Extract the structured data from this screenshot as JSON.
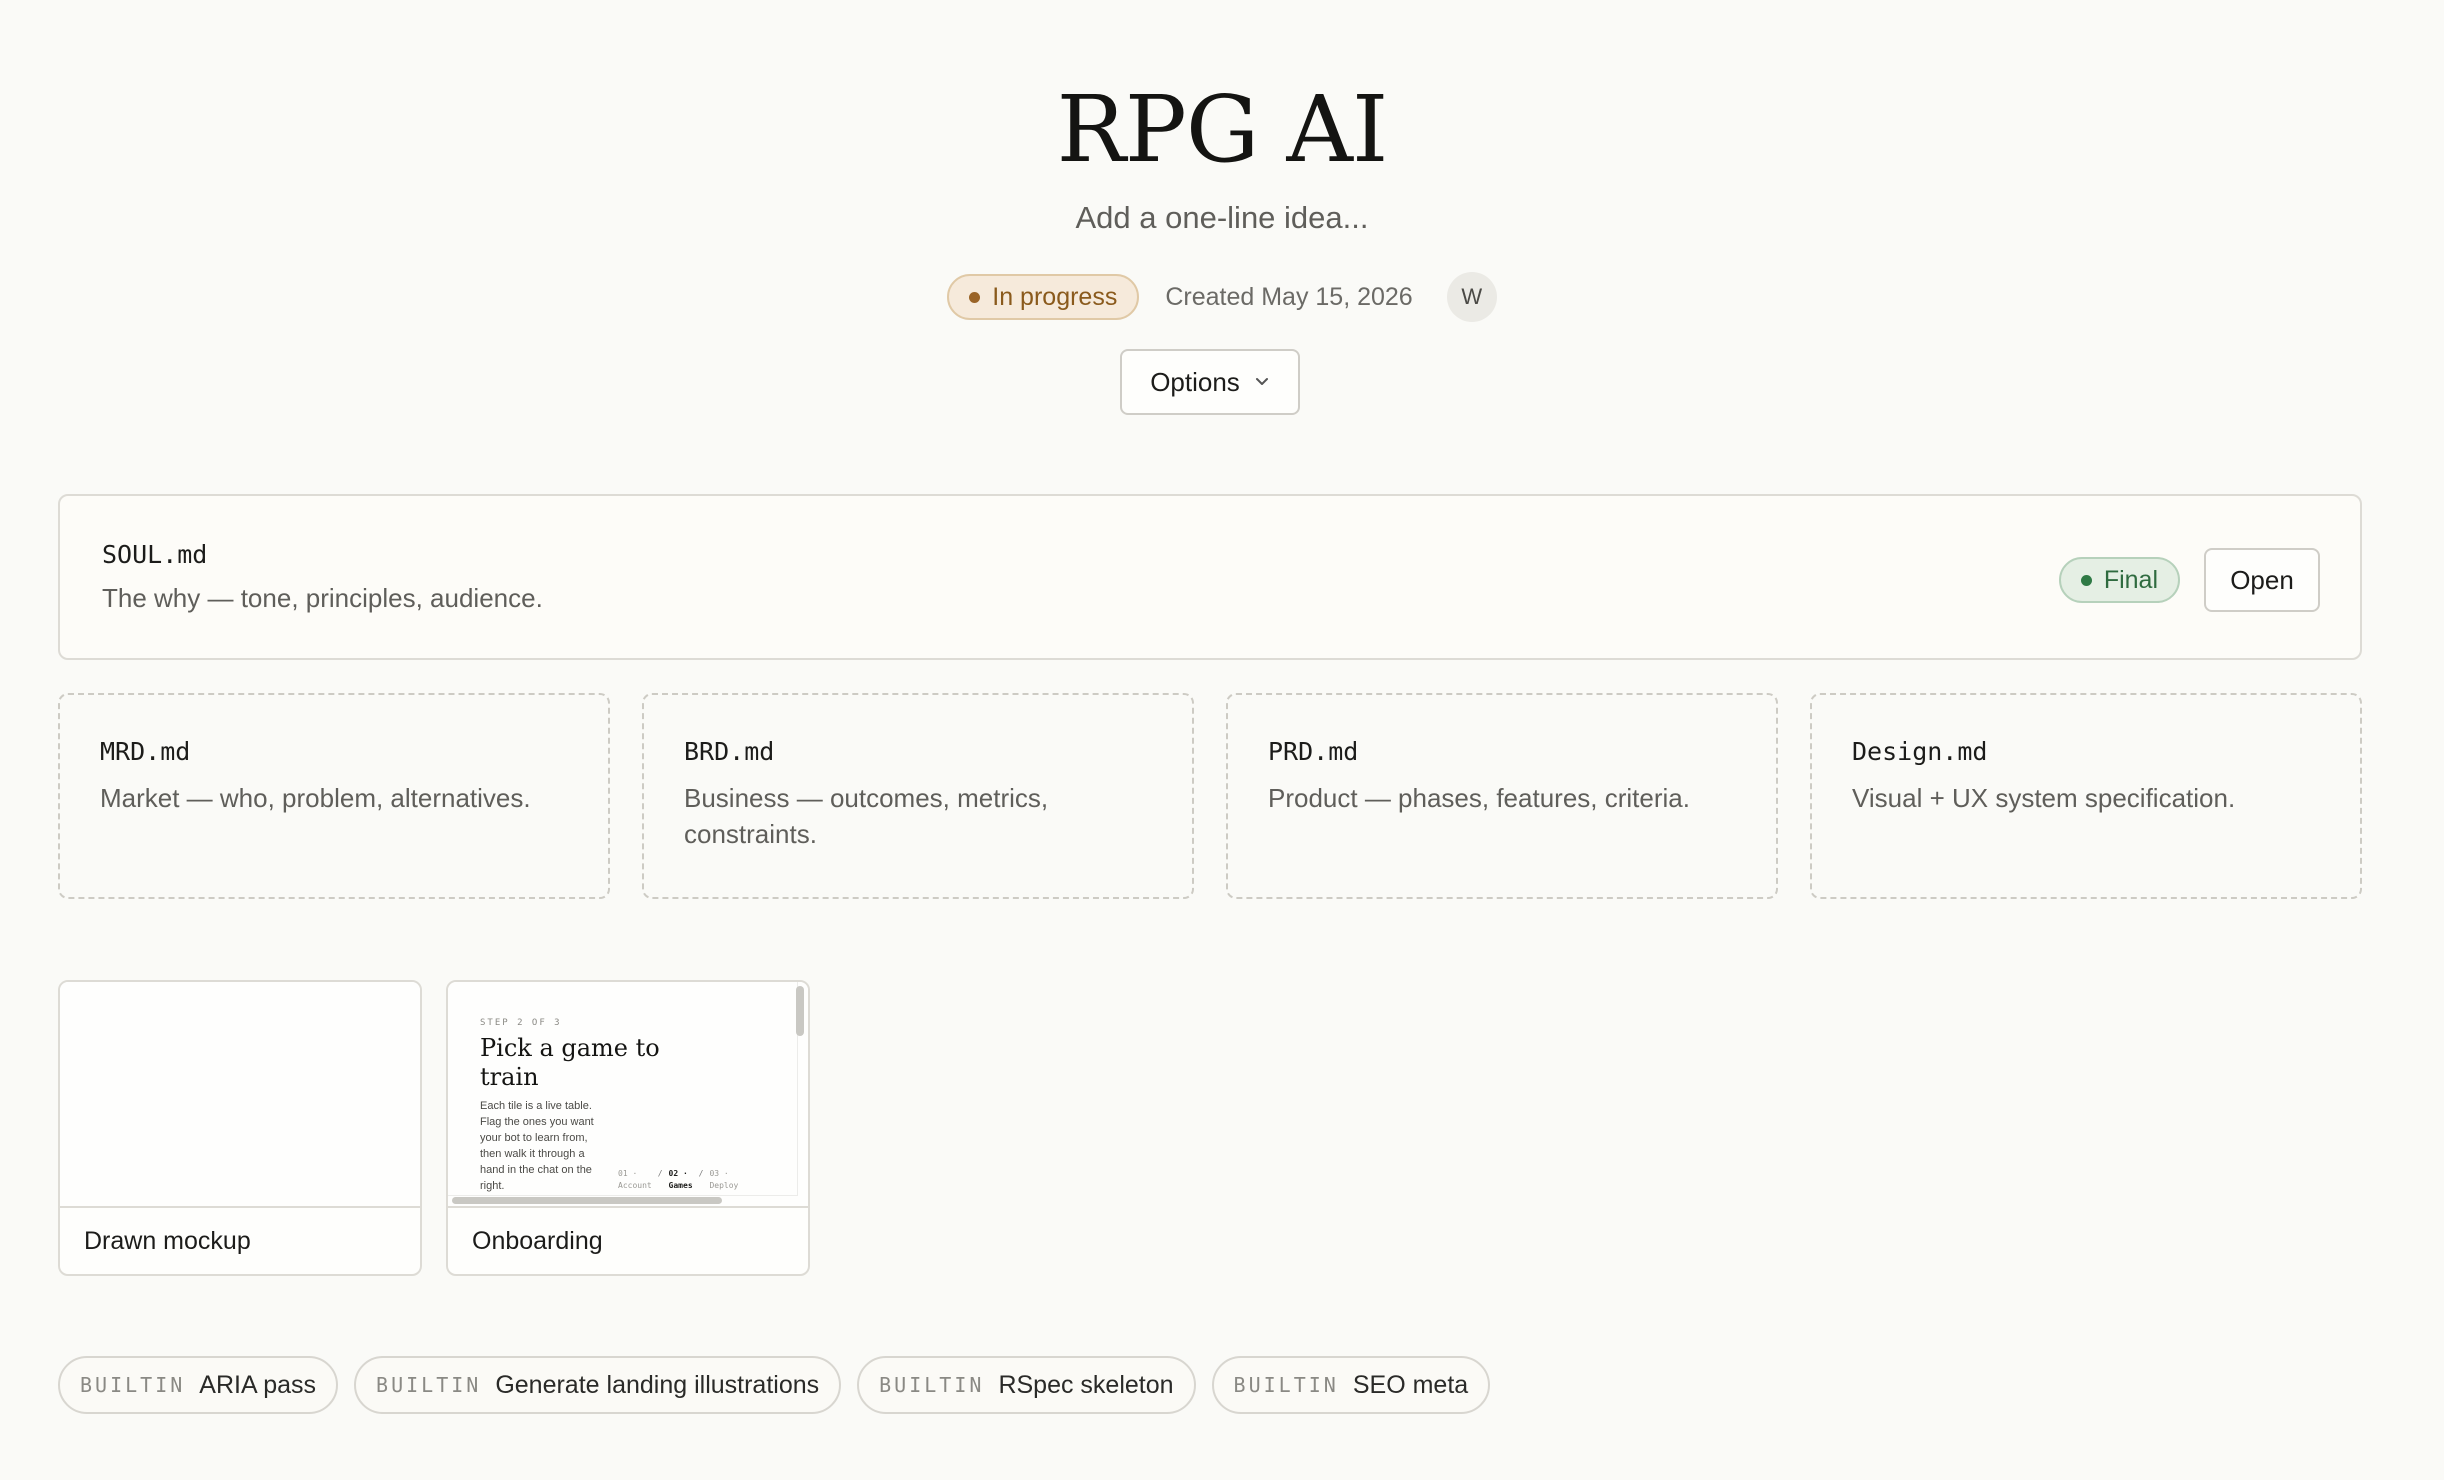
{
  "project": {
    "title": "RPG AI",
    "subtitle_placeholder": "Add a one-line idea...",
    "status": "In progress",
    "created": "Created May 15, 2026",
    "avatar_initial": "W",
    "options_label": "Options"
  },
  "soul": {
    "name": "SOUL.md",
    "description": "The why — tone, principles, audience.",
    "status": "Final",
    "open_label": "Open"
  },
  "docs": [
    {
      "name": "MRD.md",
      "description": "Market — who, problem, alternatives."
    },
    {
      "name": "BRD.md",
      "description": "Business — outcomes, metrics, constraints."
    },
    {
      "name": "PRD.md",
      "description": "Product — phases, features, criteria."
    },
    {
      "name": "Design.md",
      "description": "Visual + UX system specification."
    }
  ],
  "mockups": [
    {
      "caption": "Drawn mockup"
    },
    {
      "caption": "Onboarding",
      "preview": {
        "step": "STEP 2 OF 3",
        "title": "Pick a game to train",
        "body": "Each tile is a live table. Flag the ones you want your bot to learn from, then walk it through a hand in the chat on the right.",
        "steps": [
          {
            "num": "01 ·",
            "label": "Account"
          },
          {
            "num": "02 ·",
            "label": "Games"
          },
          {
            "num": "03 ·",
            "label": "Deploy"
          }
        ]
      }
    }
  ],
  "skills": [
    {
      "kind": "BUILTIN",
      "label": "ARIA pass"
    },
    {
      "kind": "BUILTIN",
      "label": "Generate landing illustrations"
    },
    {
      "kind": "BUILTIN",
      "label": "RSpec skeleton"
    },
    {
      "kind": "BUILTIN",
      "label": "SEO meta"
    }
  ],
  "colors": {
    "background": "#fafaf7",
    "status_in_progress": "#9a6427",
    "status_final": "#2f7a45"
  }
}
